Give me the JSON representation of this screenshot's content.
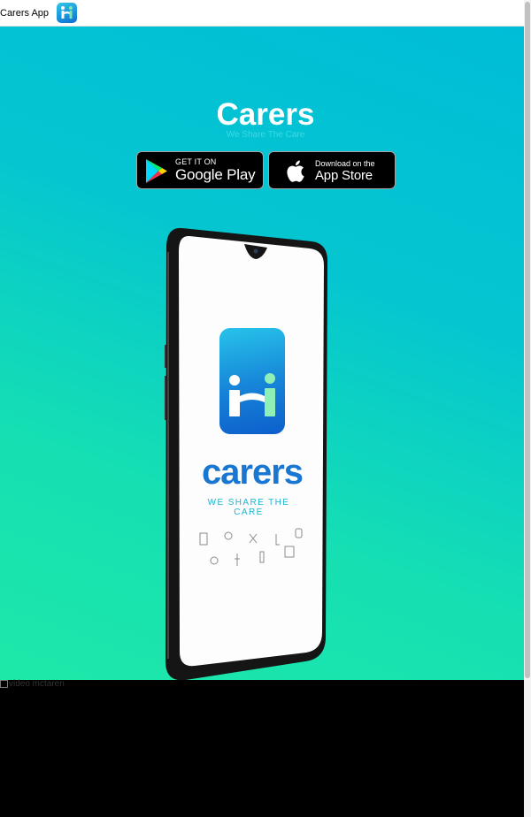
{
  "header": {
    "title": "Carers App",
    "logo_icon": "carers-logo-icon"
  },
  "hero": {
    "title": "Carers",
    "subtitle": "We Share The Care",
    "google_play": {
      "small": "GET IT ON",
      "big": "Google Play",
      "icon": "google-play-icon"
    },
    "app_store": {
      "small": "Download on the",
      "big": "App Store",
      "icon": "apple-icon"
    },
    "phone_screen": {
      "app_name": "carers",
      "tagline": "WE SHARE THE CARE"
    }
  },
  "video": {
    "fallback_text": "video mctaren"
  },
  "colors": {
    "hero_gradient_start": "#00bdd7",
    "hero_gradient_end": "#1ee8a8",
    "brand_blue": "#1976d2",
    "footer": "#000000"
  }
}
